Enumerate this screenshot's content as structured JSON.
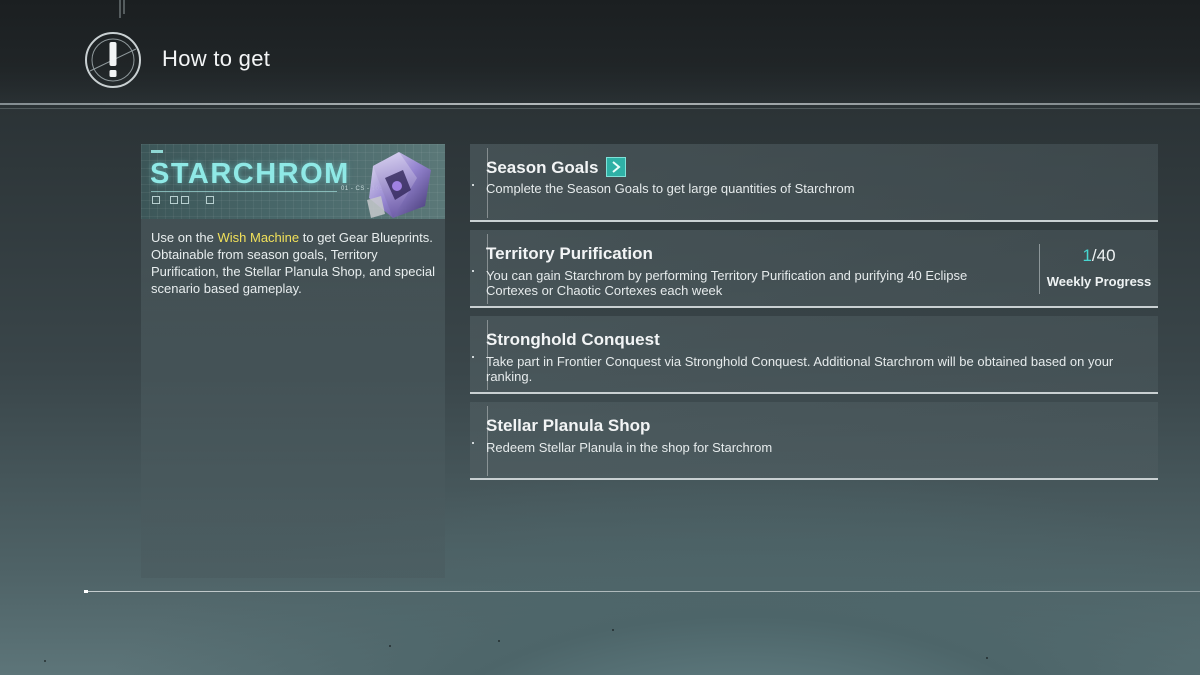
{
  "header": {
    "title": "How to get",
    "icon": "exclamation-emblem-icon"
  },
  "item": {
    "name": "STARCHROM",
    "code": "01 - CS - 103",
    "description_pre": "Use on the ",
    "description_highlight": "Wish Machine",
    "description_post": " to get Gear Blueprints. Obtainable from season goals, Territory Purification, the Stellar Planula Shop, and special scenario based gameplay.",
    "highlight_color": "#f1e05a",
    "title_color": "#8fe9e6"
  },
  "sources": [
    {
      "title": "Season Goals",
      "description": "Complete the Season Goals to get large quantities of Starchrom",
      "has_link": true
    },
    {
      "title": "Territory Purification",
      "description": "You can gain Starchrom by performing Territory Purification and purifying 40 Eclipse Cortexes or Chaotic Cortexes each week",
      "progress_current": "1",
      "progress_total": "/40",
      "progress_label": "Weekly Progress"
    },
    {
      "title": "Stronghold Conquest",
      "description": "Take part in Frontier Conquest via Stronghold Conquest. Additional Starchrom will be obtained based on your ranking."
    },
    {
      "title": "Stellar Planula Shop",
      "description": "Redeem Stellar Planula in the shop for Starchrom"
    }
  ],
  "colors": {
    "accent": "#2fb1a6",
    "progress_current": "#47d6d0"
  }
}
